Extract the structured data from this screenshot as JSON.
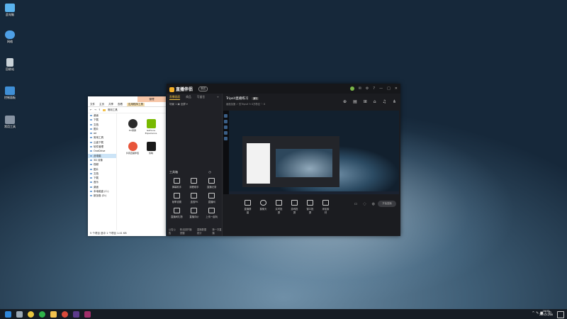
{
  "desktop": {
    "icons": [
      {
        "label": "此电脑",
        "color": "#5ab3ee"
      },
      {
        "label": "网络",
        "color": "#4ea0e6"
      },
      {
        "label": "回收站",
        "color": "#c9d2d8"
      },
      {
        "label": "控制面板",
        "color": "#3f8fd6"
      },
      {
        "label": "常用工具",
        "color": "#8894a3"
      }
    ]
  },
  "explorer": {
    "title_tab": "管理",
    "ribbon": [
      "文件",
      "主页",
      "共享",
      "查看",
      "应用程序工具"
    ],
    "address": "常用工具",
    "nav": [
      "桌面",
      "下载",
      "文档",
      "图片",
      "ae",
      "常用工具",
      "云盘下载",
      "软件管理",
      "OneDrive",
      "此电脑",
      "3D 对象",
      "视频",
      "图片",
      "文档",
      "下载",
      "音乐",
      "桌面",
      "本地磁盘 (C:)",
      "新加卷 (D:)"
    ],
    "nav_selected_index": 9,
    "files": [
      {
        "label": "EV录屏",
        "color": "#2b2b2b"
      },
      {
        "label": "GeForce Experience",
        "color": "#78b900"
      },
      {
        "label": "抖音直播伴侣",
        "color": "#e8553a"
      },
      {
        "label": "剪映",
        "color": "#1a1a1a"
      }
    ],
    "status": "5 个项目   选中 1 个项目  1.41 KB"
  },
  "app": {
    "logo_text": "直播伴侣",
    "beta_label": "测试",
    "window_controls": [
      "⊕",
      "✉",
      "⚙",
      "?",
      "—",
      "□",
      "✕"
    ],
    "left_tabs": [
      "直播画面",
      "商品",
      "写留言"
    ],
    "left_header": "场景 1",
    "left_header_icons": "▣ 全屏 ▾",
    "tools_title": "工具箱",
    "tools": [
      {
        "label": "弹幕助手"
      },
      {
        "label": "观看助手"
      },
      {
        "label": "直播记录"
      },
      {
        "label": "帧率设置"
      },
      {
        "label": "连线PK"
      },
      {
        "label": "直播间"
      },
      {
        "label": "直播间礼物"
      },
      {
        "label": "直播评价"
      },
      {
        "label": "上传一起玩"
      }
    ],
    "left_bottom": [
      "公告公告",
      "粉丝团开播提醒",
      "直播数据统计",
      "第一次直播"
    ],
    "stream_title": "Tripsit直播练习",
    "stream_badge": "通知",
    "stream_sub": "画面加速 ✓   仅Tripsit   ↻ 0万粉丝   ♡ 0",
    "header_icons": [
      "⊕",
      "▤",
      "⊞",
      "⌂",
      "♫",
      "⋔"
    ],
    "bottom_tools": [
      {
        "label": "直播屏幕"
      },
      {
        "label": "摄像头"
      },
      {
        "label": "实时投屏"
      },
      {
        "label": "游戏投屏"
      },
      {
        "label": "窗口投屏"
      },
      {
        "label": "添加素材"
      }
    ],
    "start_label": "开始直播"
  },
  "taskbar": {
    "items": [
      {
        "name": "start",
        "color": "#2f86d9"
      },
      {
        "name": "search",
        "color": "#9aa8b5"
      },
      {
        "name": "browser",
        "color": "#e9c53f"
      },
      {
        "name": "wechat",
        "color": "#2fb34a"
      },
      {
        "name": "explorer",
        "color": "#f3c24e"
      },
      {
        "name": "chrome",
        "color": "#d94a3a"
      },
      {
        "name": "app",
        "color": "#5c3a8a"
      },
      {
        "name": "live",
        "color": "#a02f6a"
      }
    ],
    "tray": "^ ✎ ■ ♪ 中",
    "time": "18:55",
    "date": "2021/12/08"
  }
}
